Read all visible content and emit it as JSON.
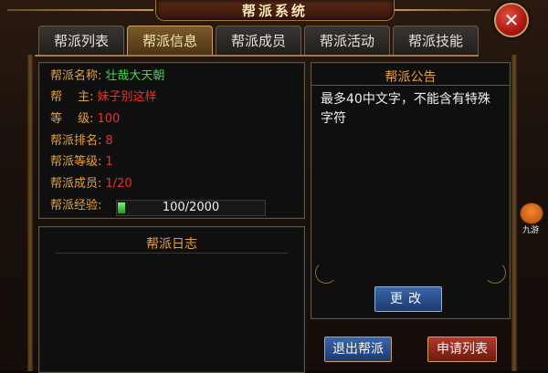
{
  "window": {
    "title": "帮派系统",
    "close_label": "✕"
  },
  "tabs": [
    {
      "label": "帮派列表",
      "active": false
    },
    {
      "label": "帮派信息",
      "active": true
    },
    {
      "label": "帮派成员",
      "active": false
    },
    {
      "label": "帮派活动",
      "active": false
    },
    {
      "label": "帮派技能",
      "active": false
    }
  ],
  "info": {
    "name_label": "帮派名称:",
    "name_value": "壮哉大天朝",
    "leader_label": "帮　 主:",
    "leader_value": "妹子别这样",
    "level_label": "等　 级:",
    "level_value": "100",
    "rank_label": "帮派排名:",
    "rank_value": "8",
    "guild_level_label": "帮派等级:",
    "guild_level_value": "1",
    "members_label": "帮派成员:",
    "members_value": "1/20",
    "exp_label": "帮派经验:",
    "exp_text": "100/2000",
    "exp_current": 100,
    "exp_max": 2000
  },
  "log": {
    "title": "帮派日志"
  },
  "notice": {
    "title": "帮派公告",
    "text": "最多40中文字，不能含有特殊字符"
  },
  "buttons": {
    "change_label": "更改",
    "exit_label": "退出帮派",
    "apply_label": "申请列表"
  },
  "side_logo": {
    "label": "九游"
  },
  "colors": {
    "label_orange": "#e8a13a",
    "value_green": "#3fd84a",
    "value_red": "#e8332a",
    "active_tab_gold": "#c9a062"
  }
}
